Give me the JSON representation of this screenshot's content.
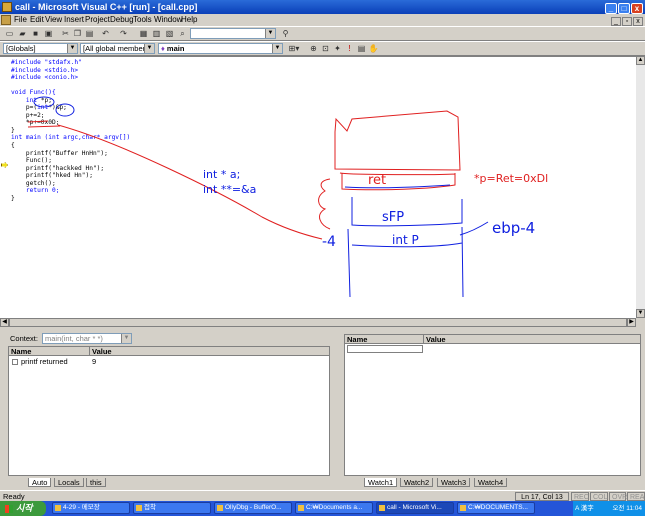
{
  "window": {
    "title": "call - Microsoft Visual C++ [run] - [call.cpp]",
    "controls": [
      "_",
      "□",
      "x"
    ]
  },
  "menu": {
    "items": [
      "File",
      "Edit",
      "View",
      "Insert",
      "Project",
      "Debug",
      "Tools",
      "Window",
      "Help"
    ],
    "mdi_controls": [
      "_",
      "▫",
      "x"
    ]
  },
  "toolbar": {
    "find_combo_value": "",
    "globals_combo": "[Globals]",
    "members_combo": "[All global members",
    "function_combo": "main"
  },
  "editor": {
    "lines": [
      "#include \"stdafx.h\"",
      "#include <stdio.h>",
      "#include <conio.h>",
      "",
      "void Func(){",
      "    int *p;",
      "    p=(int*)&p;",
      "    p+=2;",
      "    *p+=0x0D;",
      "}",
      "int main (int argc,char* argv[])",
      "{",
      "    printf(\"Buffer HnHn\");",
      "    Func();",
      "    printf(\"hackked Hn\");",
      "    printf(\"hked Hn\");",
      "    getch();",
      "    return 0;",
      "}"
    ],
    "annotations": {
      "note1": "int * a;",
      "note2": "int **=&a",
      "ret_label": "ret",
      "ret_eq": "*p=Ret=0xDl",
      "sfp_label": "sFP",
      "intp_label": "int P",
      "ebp_label": "ebp-4",
      "minus4": "-4"
    },
    "annotation_colors": {
      "red": "#e02020",
      "blue": "#1020e0"
    }
  },
  "variables_pane": {
    "context_label": "Context:",
    "context_value": "main(int, char * *)",
    "headers": [
      "Name",
      "Value"
    ],
    "rows": [
      {
        "name": "printf returned",
        "value": "9"
      }
    ],
    "tabs": [
      "Auto",
      "Locals",
      "this"
    ]
  },
  "watch_pane": {
    "headers": [
      "Name",
      "Value"
    ],
    "tabs": [
      "Watch1",
      "Watch2",
      "Watch3",
      "Watch4"
    ]
  },
  "status": {
    "text": "Ready",
    "position": "Ln 17, Col 13",
    "indicators": [
      "REC",
      "COL",
      "OVR",
      "READ"
    ]
  },
  "taskbar": {
    "start_label": "시작",
    "tasks": [
      "4-29 - 메모장",
      "접착",
      "OllyDbg - BufferO...",
      "C:₩Documents a...",
      "call - Microsoft Vi...",
      "C:₩DOCUMENTS..."
    ],
    "clock": "오전 11:04",
    "ime": "A 漢字"
  }
}
